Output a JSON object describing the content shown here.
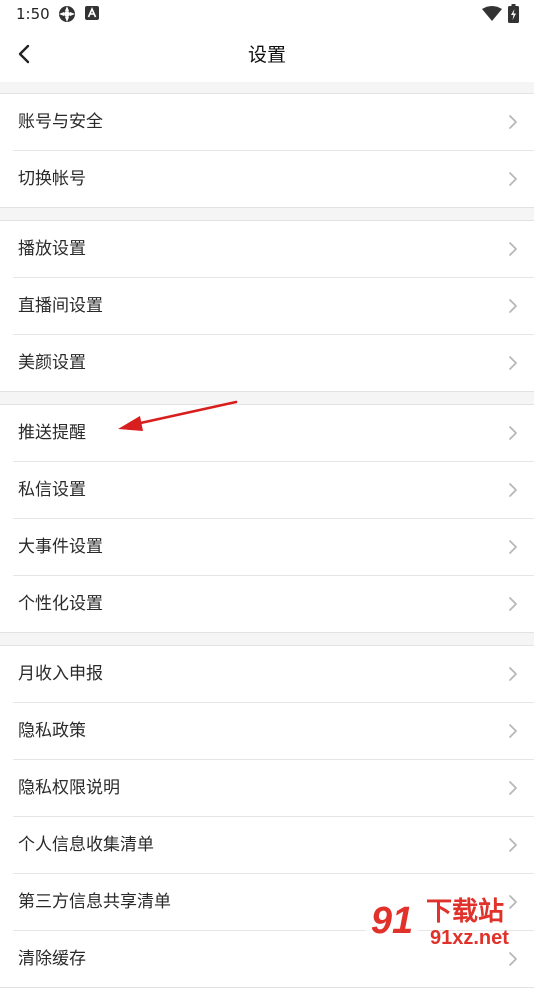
{
  "status_bar": {
    "time": "1:50",
    "icons": [
      "settings-gear-icon",
      "app-a-icon",
      "wifi-icon",
      "battery-charging-icon"
    ]
  },
  "header": {
    "title": "设置",
    "back_icon": "chevron-left-icon"
  },
  "groups": [
    {
      "items": [
        {
          "label": "账号与安全"
        },
        {
          "label": "切换帐号"
        }
      ]
    },
    {
      "items": [
        {
          "label": "播放设置"
        },
        {
          "label": "直播间设置"
        },
        {
          "label": "美颜设置"
        }
      ]
    },
    {
      "items": [
        {
          "label": "推送提醒"
        },
        {
          "label": "私信设置"
        },
        {
          "label": "大事件设置"
        },
        {
          "label": "个性化设置"
        }
      ]
    },
    {
      "items": [
        {
          "label": "月收入申报"
        },
        {
          "label": "隐私政策"
        },
        {
          "label": "隐私权限说明"
        },
        {
          "label": "个人信息收集清单"
        },
        {
          "label": "第三方信息共享清单"
        },
        {
          "label": "清除缓存"
        }
      ]
    }
  ],
  "annotation": {
    "arrow_color": "#d81e1e",
    "points_to": "推送提醒"
  },
  "watermark": {
    "logo": "91",
    "text": "下载站",
    "url": "91xz.net",
    "color": "#e0312b"
  },
  "colors": {
    "background": "#f5f5f5",
    "row_bg": "#ffffff",
    "divider": "#e6e6e6",
    "chevron": "#b8b8b8"
  }
}
